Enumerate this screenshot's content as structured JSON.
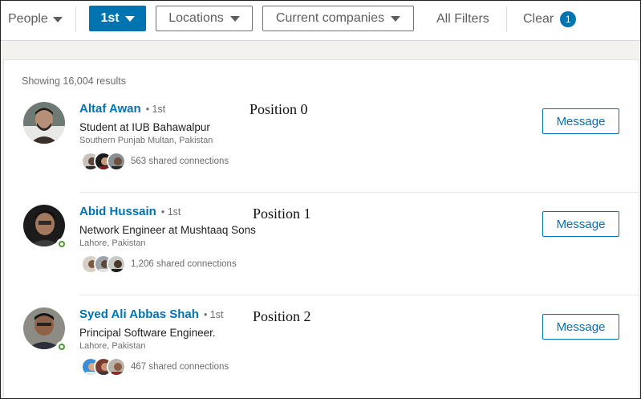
{
  "filters": {
    "people_label": "People",
    "first_degree_label": "1st",
    "locations_label": "Locations",
    "companies_label": "Current companies",
    "all_filters_label": "All Filters",
    "clear_label": "Clear",
    "clear_count": "1"
  },
  "results": {
    "summary": "Showing 16,004 results",
    "items": [
      {
        "name": "Altaf Awan",
        "degree": "• 1st",
        "headline": "Student at IUB Bahawalpur",
        "location": "Southern Punjab Multan, Pakistan",
        "shared": "563 shared connections",
        "message_label": "Message",
        "position_label": "Position 0",
        "online": false
      },
      {
        "name": "Abid Hussain",
        "degree": "• 1st",
        "headline": "Network Engineer at Mushtaaq Sons",
        "location": "Lahore, Pakistan",
        "shared": "1,206 shared connections",
        "message_label": "Message",
        "position_label": "Position 1",
        "online": true
      },
      {
        "name": "Syed Ali Abbas Shah",
        "degree": "• 1st",
        "headline": "Principal Software Engineer.",
        "location": "Lahore, Pakistan",
        "shared": "467 shared connections",
        "message_label": "Message",
        "position_label": "Position 2",
        "online": true
      }
    ]
  },
  "colors": {
    "accent": "#0073b1",
    "online_green": "#4d9a2f"
  }
}
